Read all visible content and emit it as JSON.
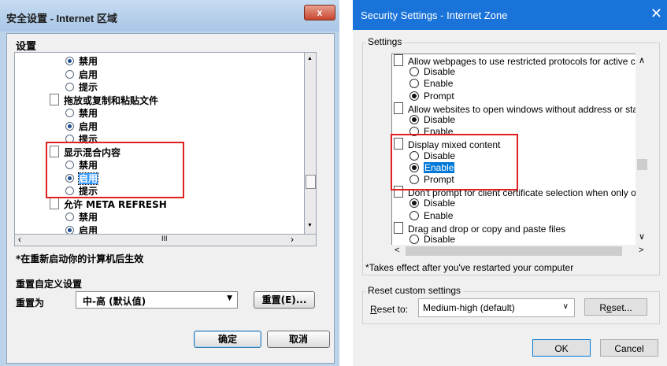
{
  "left": {
    "title": "安全设置 - Internet 区域",
    "close": "x",
    "settings_label": "设置",
    "rows": [
      {
        "kind": "radio",
        "label": "禁用",
        "checked": true
      },
      {
        "kind": "radio",
        "label": "启用",
        "checked": false
      },
      {
        "kind": "radio",
        "label": "提示",
        "checked": false
      },
      {
        "kind": "doc",
        "label": "拖放或复制和粘贴文件"
      },
      {
        "kind": "radio",
        "label": "禁用",
        "checked": false
      },
      {
        "kind": "radio",
        "label": "启用",
        "checked": true
      },
      {
        "kind": "radio",
        "label": "提示",
        "checked": false
      },
      {
        "kind": "doc",
        "label": "显示混合内容"
      },
      {
        "kind": "radio",
        "label": "禁用",
        "checked": false
      },
      {
        "kind": "radio",
        "label": "启用",
        "checked": true
      },
      {
        "kind": "radio",
        "label": "提示",
        "checked": false
      },
      {
        "kind": "doc",
        "label": "允许 META REFRESH"
      },
      {
        "kind": "radio",
        "label": "禁用",
        "checked": false
      },
      {
        "kind": "radio",
        "label": "启用",
        "checked": true
      }
    ],
    "hscroll_left": "‹",
    "hscroll_mid": "III",
    "hscroll_right": "›",
    "vscroll_up": "▲",
    "vscroll_down": "▼",
    "note": "*在重新启动你的计算机后生效",
    "reset_group": "重置自定义设置",
    "reset_to": "重置为",
    "reset_value": "中-高 (默认值)",
    "reset_button": "重置(E)...",
    "ok": "确定",
    "cancel": "取消"
  },
  "right": {
    "title": "Security Settings - Internet Zone",
    "close": "✕",
    "settings_label": "Settings",
    "rows": [
      {
        "kind": "doc",
        "label": "Allow webpages to use restricted protocols for active conten"
      },
      {
        "kind": "radio",
        "label": "Disable",
        "checked": false
      },
      {
        "kind": "radio",
        "label": "Enable",
        "checked": false
      },
      {
        "kind": "radio",
        "label": "Prompt",
        "checked": true
      },
      {
        "kind": "doc",
        "label": "Allow websites to open windows without address or status ba"
      },
      {
        "kind": "radio",
        "label": "Disable",
        "checked": true
      },
      {
        "kind": "radio",
        "label": "Enable",
        "checked": false
      },
      {
        "kind": "doc",
        "label": "Display mixed content"
      },
      {
        "kind": "radio",
        "label": "Disable",
        "checked": false
      },
      {
        "kind": "radio",
        "label": "Enable",
        "checked": true,
        "selected": true
      },
      {
        "kind": "radio",
        "label": "Prompt",
        "checked": false
      },
      {
        "kind": "doc",
        "label": "Don't prompt for client certificate selection when only one ce"
      },
      {
        "kind": "radio",
        "label": "Disable",
        "checked": true
      },
      {
        "kind": "radio",
        "label": "Enable",
        "checked": false
      },
      {
        "kind": "doc",
        "label": "Drag and drop or copy and paste files"
      },
      {
        "kind": "radio",
        "label": "Disable",
        "checked": false
      }
    ],
    "vscroll_up": "∧",
    "vscroll_down": "∨",
    "hscroll_left": "<",
    "hscroll_right": ">",
    "note": "*Takes effect after you've restarted your computer",
    "reset_group": "Reset custom settings",
    "reset_to_prefix": "R",
    "reset_to_rest": "eset to:",
    "reset_value": "Medium-high (default)",
    "reset_button_a": "R",
    "reset_button_u": "e",
    "reset_button_b": "set...",
    "ok": "OK",
    "cancel": "Cancel"
  },
  "colors": {
    "highlight_box": "#e02020",
    "win10_accent": "#1a73d9",
    "selection": "#0078d7"
  }
}
